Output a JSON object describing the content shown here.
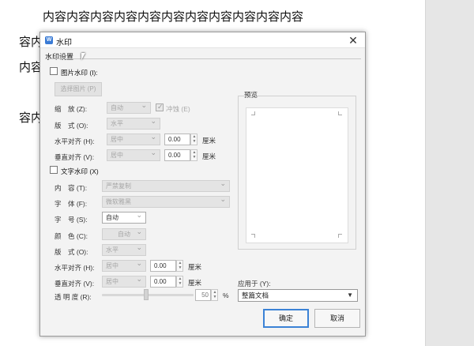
{
  "document": {
    "line1": "内容内容内容内容内容内容内容内容内容内容内容",
    "line2": "容内",
    "line3": "内容",
    "line4": "容内"
  },
  "dialog": {
    "title": "水印",
    "section_label": "水印设置",
    "picture_watermark": {
      "checkbox_label": "图片水印 (I):",
      "select_picture_button": "选择图片 (P)",
      "scale_label": "缩　放 (Z):",
      "scale_value": "自动",
      "washout_label": "冲蚀 (E)",
      "layout_label": "版　式 (O):",
      "layout_value": "水平",
      "halign_label": "水平对齐 (H):",
      "halign_value": "居中",
      "halign_offset": "0.00",
      "valign_label": "垂直对齐 (V):",
      "valign_value": "居中",
      "valign_offset": "0.00",
      "unit": "厘米"
    },
    "text_watermark": {
      "checkbox_label": "文字水印 (X)",
      "content_label": "内　容 (T):",
      "content_value": "严禁复制",
      "font_label": "字　体 (F):",
      "font_value": "微软雅黑",
      "size_label": "字　号 (S):",
      "size_value": "自动",
      "color_label": "颜　色 (C):",
      "color_value": "自动",
      "layout_label": "版　式 (O):",
      "layout_value": "水平",
      "halign_label": "水平对齐 (H):",
      "halign_value": "居中",
      "halign_offset": "0.00",
      "valign_label": "垂直对齐 (V):",
      "valign_value": "居中",
      "valign_offset": "0.00",
      "unit": "厘米",
      "transparency_label": "透 明 度 (R):",
      "transparency_value": "50",
      "transparency_unit": "%"
    },
    "preview_label": "预览",
    "apply_to_label": "应用于 (Y):",
    "apply_to_value": "整篇文档",
    "ok_button": "确定",
    "cancel_button": "取消"
  },
  "colors": {
    "accent": "#3b82d6",
    "app_icon": "#3a7bd5"
  }
}
